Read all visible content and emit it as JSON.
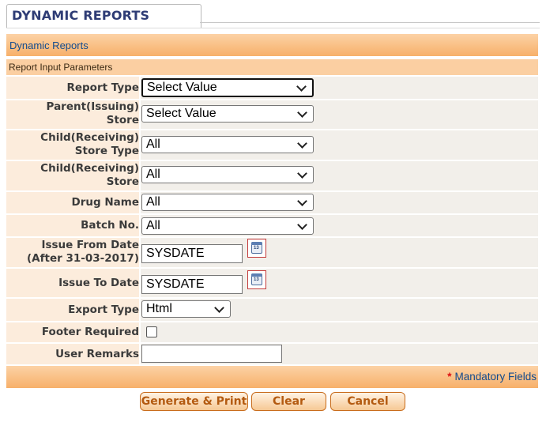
{
  "tab": {
    "title": "DYNAMIC REPORTS"
  },
  "header": {
    "title": "Dynamic Reports",
    "subtitle": "Report Input Parameters"
  },
  "form": {
    "report_type": {
      "label": "Report Type",
      "value": "Select Value"
    },
    "parent_store": {
      "label_line1": "Parent(Issuing)",
      "label_line2": "Store",
      "value": "Select Value"
    },
    "child_store_type": {
      "label_line1": "Child(Receiving)",
      "label_line2": "Store Type",
      "value": "All"
    },
    "child_store": {
      "label_line1": "Child(Receiving)",
      "label_line2": "Store",
      "value": "All"
    },
    "drug_name": {
      "label": "Drug Name",
      "value": "All"
    },
    "batch_no": {
      "label": "Batch No.",
      "value": "All"
    },
    "issue_from_date": {
      "label_line1": "Issue From Date",
      "label_line2": "(After 31-03-2017)",
      "value": "SYSDATE"
    },
    "issue_to_date": {
      "label": "Issue To Date",
      "value": "SYSDATE"
    },
    "export_type": {
      "label": "Export Type",
      "value": "Html"
    },
    "footer_required": {
      "label": "Footer Required",
      "checked": false
    },
    "user_remarks": {
      "label": "User Remarks",
      "value": ""
    }
  },
  "calendar_icon_text": "13",
  "footer": {
    "mandatory_star": "*",
    "mandatory_text": "Mandatory Fields"
  },
  "buttons": {
    "generate": "Generate & Print",
    "clear": "Clear",
    "cancel": "Cancel"
  },
  "colors": {
    "header_gradient_top": "#fcd2a5",
    "header_gradient_bottom": "#f7b06a",
    "label_bg": "#fcecdc",
    "value_bg": "#f2efea",
    "link_blue": "#124b8e",
    "button_text": "#b35a10"
  }
}
